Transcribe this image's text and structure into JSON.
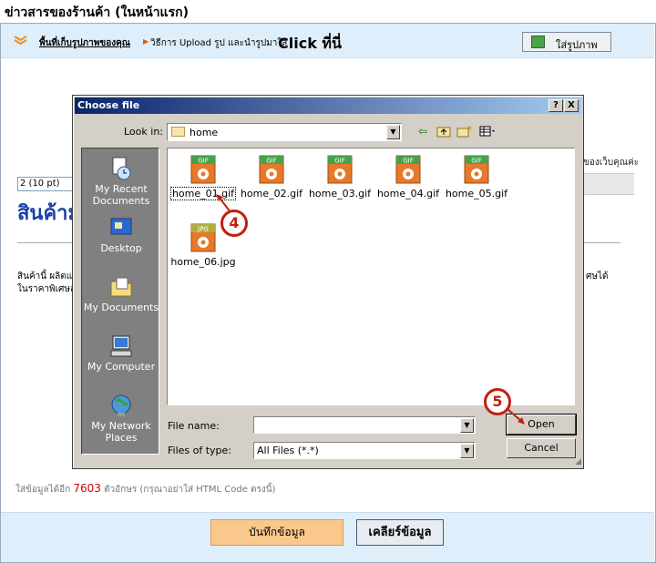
{
  "page": {
    "title": "ข่าวสารของร้านค้า (ในหน้าแรก)",
    "upload_link": "พื้นที่เก็บรูปภาพของคุณ",
    "upload_text": "วิธีการ Upload รูป และนำรูปมาใส่",
    "upload_click": "Click ที่นี่",
    "insert_image_label": "ใส่รูปภาพ",
    "font_size_value": "2 (10 pt)",
    "partial_right_text": "ของเว็บคุณค่ะ",
    "product_heading": "สินค้าม",
    "body_line_1": "สินค้านี้ ผลิตแ",
    "body_line_2": "ในราคาพิเศษสุ",
    "body_right": "ศษได้",
    "char_info_prefix": "ใส่ข้อมูลได้อีก",
    "char_count": "7603",
    "char_info_suffix": "ตัวอักษร (กรุณาอย่าใส่ HTML Code ตรงนี้)",
    "save_label": "บันทึกข้อมูล",
    "clear_label": "เคลียร์ข้อมูล"
  },
  "dialog": {
    "title": "Choose file",
    "help_btn": "?",
    "close_btn": "X",
    "look_in_label": "Look in:",
    "look_in_value": "home",
    "places": [
      {
        "label": "My Recent Documents",
        "icon": "recent-documents-icon"
      },
      {
        "label": "Desktop",
        "icon": "desktop-icon"
      },
      {
        "label": "My Documents",
        "icon": "my-documents-icon"
      },
      {
        "label": "My Computer",
        "icon": "my-computer-icon"
      },
      {
        "label": "My Network Places",
        "icon": "network-places-icon"
      }
    ],
    "files": [
      {
        "name": "home_01.gif",
        "type": "GIF"
      },
      {
        "name": "home_02.gif",
        "type": "GIF"
      },
      {
        "name": "home_03.gif",
        "type": "GIF"
      },
      {
        "name": "home_04.gif",
        "type": "GIF"
      },
      {
        "name": "home_05.gif",
        "type": "GIF"
      },
      {
        "name": "home_06.jpg",
        "type": "JPG"
      }
    ],
    "file_name_label": "File name:",
    "file_name_value": "",
    "files_of_type_label": "Files of type:",
    "files_of_type_value": "All Files (*.*)",
    "open_label": "Open",
    "cancel_label": "Cancel"
  },
  "callouts": {
    "step_4": "4",
    "step_5": "5"
  },
  "colors": {
    "accent_red": "#c02010",
    "titlebar_start": "#0a246a",
    "titlebar_end": "#a6caf0",
    "page_bar": "#dfeefb",
    "save_button": "#fac88a",
    "heading_blue": "#1a3fa8"
  }
}
